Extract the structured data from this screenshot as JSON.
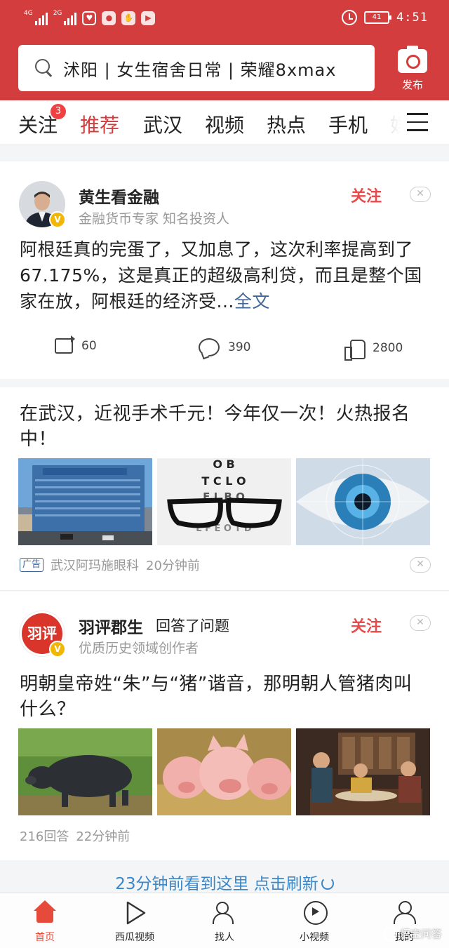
{
  "status_bar": {
    "net1": "4G",
    "net2": "2G",
    "battery": "41",
    "time": "4:51"
  },
  "search": {
    "query": "沭阳 | 女生宿舍日常 | 荣耀8xmax"
  },
  "publish": {
    "label": "发布"
  },
  "tabs": [
    {
      "label": "关注"
    },
    {
      "label": "推荐"
    },
    {
      "label": "武汉"
    },
    {
      "label": "视频"
    },
    {
      "label": "热点"
    },
    {
      "label": "手机"
    },
    {
      "label": "娱"
    }
  ],
  "follow_badge": "3",
  "post1": {
    "author": "黄生看金融",
    "subtitle": "金融货币专家 知名投资人",
    "follow_label": "关注",
    "text": "阿根廷真的完蛋了，又加息了，这次利率提高到了67.175%，这是真正的超级高利贷，而且是整个国家在放，阿根廷的经济受...",
    "more": "全文",
    "reposts": "60",
    "comments": "390",
    "likes": "2800"
  },
  "ad": {
    "title": "在武汉，近视手术千元！今年仅一次！火热报名中！",
    "tag": "广告",
    "source": "武汉阿玛施眼科",
    "time": "20分钟前"
  },
  "post2": {
    "avatar_text": "羽评",
    "author": "羽评郡生",
    "action": "回答了问题",
    "subtitle": "优质历史领域创作者",
    "follow_label": "关注",
    "title": "明朝皇帝姓“朱”与“猪”谐音，那明朝人管猪肉叫什么？",
    "answers": "216回答",
    "time": "22分钟前"
  },
  "refresh": {
    "text": "23分钟前看到这里 点击刷新"
  },
  "bottom_nav": [
    {
      "label": "首页"
    },
    {
      "label": "西瓜视频"
    },
    {
      "label": "找人"
    },
    {
      "label": "小视频"
    },
    {
      "label": "我的"
    }
  ],
  "watermark": "悟空问答",
  "colors": {
    "brand_red": "#d43d3d",
    "link_blue": "#406599",
    "refresh_blue": "#3a86c8"
  }
}
